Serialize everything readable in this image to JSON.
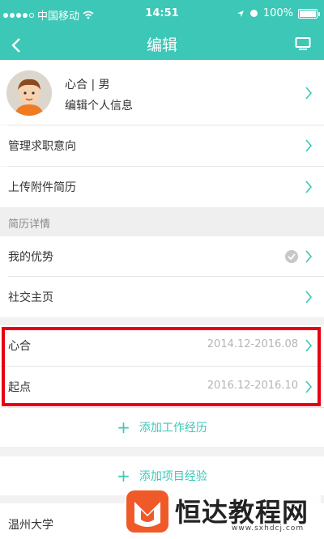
{
  "status_bar": {
    "carrier": "中国移动",
    "time": "14:51",
    "battery": "100%"
  },
  "nav": {
    "back_icon": "chevron-left-icon",
    "title": "编辑",
    "preview_icon": "monitor-icon"
  },
  "profile": {
    "name_gender": "心合 | 男",
    "edit_label": "编辑个人信息"
  },
  "menu": {
    "job_intention": "管理求职意向",
    "upload_attachment": "上传附件简历"
  },
  "resume_section": {
    "header": "简历详情",
    "advantage": "我的优势",
    "social": "社交主页"
  },
  "work_experience": [
    {
      "company": "心合",
      "period": "2014.12-2016.08"
    },
    {
      "company": "起点",
      "period": "2016.12-2016.10"
    }
  ],
  "actions": {
    "add_work": "添加工作经历",
    "add_project": "添加项目经验"
  },
  "education": {
    "school": "温州大学"
  },
  "watermark": {
    "brand": "恒达教程网",
    "url": "www.sxhdcj.com"
  },
  "colors": {
    "accent": "#3dc7b7",
    "highlight": "#e60012"
  }
}
